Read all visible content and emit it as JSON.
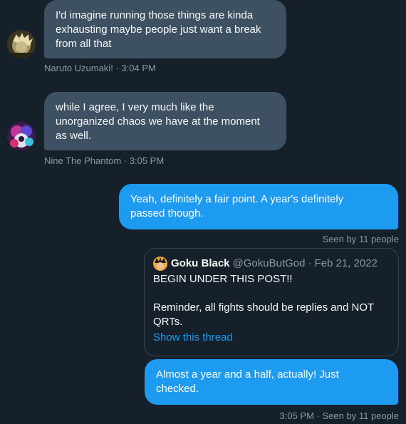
{
  "messages": [
    {
      "sender": "Naruto Uzumaki!",
      "time": "3:04 PM",
      "lines": [
        "I'd imagine running those things are kinda",
        "exhausting maybe people just want a break",
        "from all that"
      ]
    },
    {
      "sender": "Nine The Phantom",
      "time": "3:05 PM",
      "lines": [
        "while I agree, I very much like the",
        "unorganized chaos we have at the moment",
        "as well."
      ]
    }
  ],
  "sent": [
    {
      "lines": [
        "Yeah, definitely a fair point. A year's definitely",
        "passed though."
      ],
      "seen": "Seen by 11 people"
    },
    {
      "lines": [
        "Almost a year and a half, actually! Just",
        "checked."
      ],
      "time": "3:05 PM",
      "seen": "Seen by 11 people"
    }
  ],
  "quote": {
    "name": "Goku Black",
    "handle": "@GokuButGod",
    "date": "Feb 21, 2022",
    "body_line1": "BEGIN UNDER THIS POST!!",
    "body_line2": "Reminder, all fights should be replies and NOT",
    "body_line3": "QRTs.",
    "show_thread": "Show this thread"
  },
  "separator": "·",
  "colors": {
    "background": "#15202b",
    "incoming_bubble": "#3e5163",
    "outgoing_bubble": "#1d9bf0",
    "muted_text": "#8b98a5",
    "link": "#1d9bf0"
  }
}
